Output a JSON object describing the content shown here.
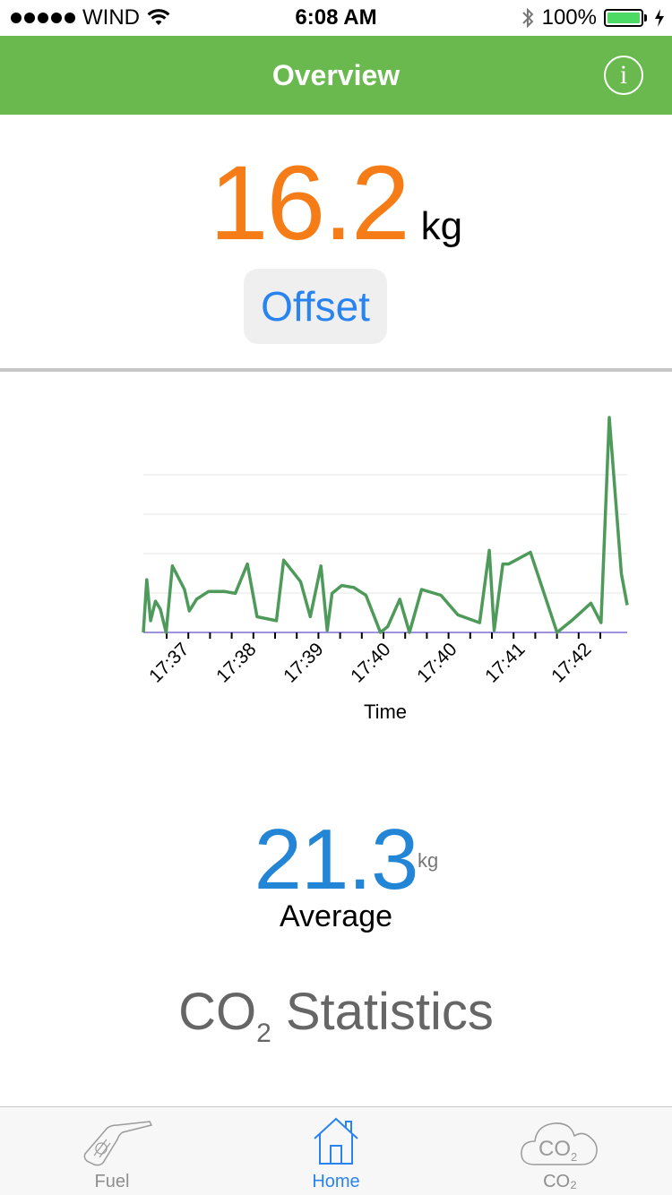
{
  "status_bar": {
    "carrier": "WIND",
    "time": "6:08 AM",
    "battery": "100%"
  },
  "nav": {
    "title": "Overview",
    "info_glyph": "i"
  },
  "offset": {
    "value": "16.2",
    "unit": "kg",
    "button_label": "Offset"
  },
  "average": {
    "value": "21.3",
    "unit": "kg",
    "label": "Average"
  },
  "stats": {
    "title_prefix": "CO",
    "title_sub": "2",
    "title_suffix": " Statistics"
  },
  "tabs": [
    {
      "label": "Fuel",
      "icon": "fuel-pump-icon",
      "active": false
    },
    {
      "label": "Home",
      "icon": "home-icon",
      "active": true
    },
    {
      "label": "CO₂",
      "icon": "co2-cloud-icon",
      "active": false
    }
  ],
  "colors": {
    "nav_green": "#6ab94f",
    "offset_orange": "#f57c17",
    "average_blue": "#2385d6",
    "link_blue": "#2a84f0",
    "series_green": "#4e9a5a"
  },
  "chart_data": {
    "type": "line",
    "xlabel": "Time",
    "ylabel": "",
    "x_tick_labels": [
      "17:37",
      "17:38",
      "17:39",
      "17:40",
      "17:40",
      "17:41",
      "17:42"
    ],
    "x_range": [
      0,
      100
    ],
    "ylim": [
      0,
      5.5
    ],
    "grid": true,
    "x": [
      0,
      0.7,
      1.5,
      2.5,
      3.5,
      4.7,
      6,
      8.5,
      9.5,
      11,
      13.5,
      16.7,
      19,
      21.5,
      23.5,
      27.5,
      29,
      32.5,
      34.5,
      36.7,
      38,
      39,
      41,
      43.5,
      46,
      49,
      50.5,
      53,
      55,
      57.5,
      61.5,
      65,
      69.5,
      71.5,
      72.5,
      74.3,
      75.5,
      80,
      85.5,
      88.5,
      92.5,
      94.6,
      96.3,
      98.8,
      100
    ],
    "y": [
      0,
      1.35,
      0.3,
      0.8,
      0.6,
      0,
      1.7,
      1.1,
      0.55,
      0.85,
      1.05,
      1.05,
      1.0,
      1.75,
      0.4,
      0.3,
      1.85,
      1.3,
      0.4,
      1.7,
      0.05,
      1.0,
      1.2,
      1.15,
      0.95,
      0,
      0.15,
      0.85,
      0,
      1.1,
      0.95,
      0.45,
      0.25,
      2.1,
      0.05,
      1.75,
      1.75,
      2.05,
      0,
      0.3,
      0.75,
      0.25,
      5.5,
      1.5,
      0.7
    ]
  }
}
